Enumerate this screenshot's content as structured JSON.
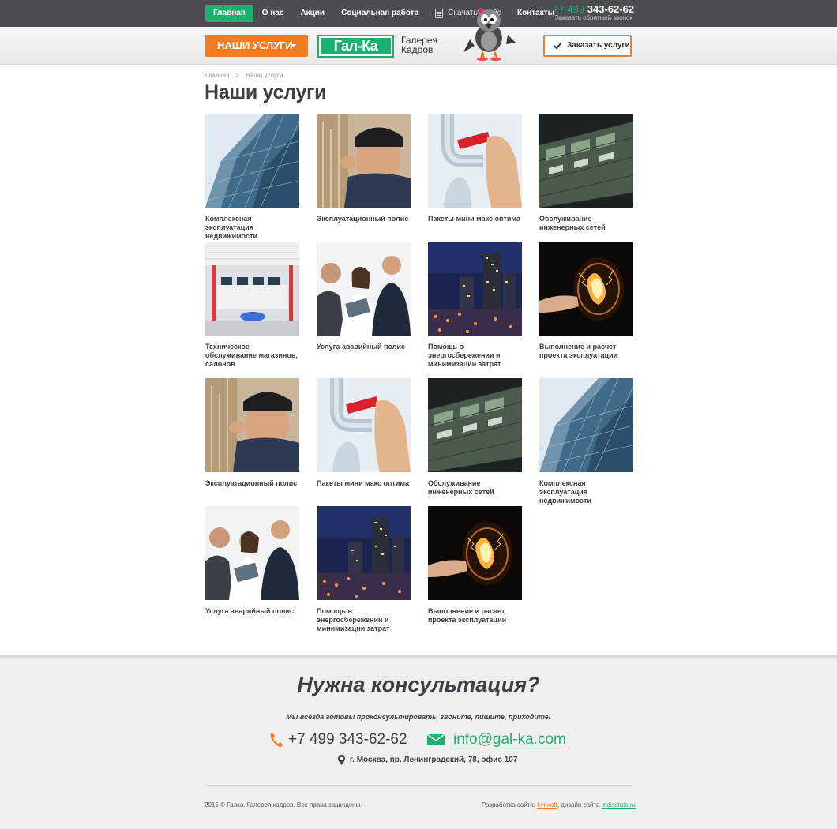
{
  "nav": {
    "items": [
      "Главная",
      "О нас",
      "Акции",
      "Социальная работа"
    ],
    "price_label": "Скачать прайс",
    "contacts_label": "Контакты",
    "phone_code": "+7 499",
    "phone_number": "343-62-62",
    "callback_label": "Заказать обратный звонок"
  },
  "header": {
    "services_button": "НАШИ УСЛУГИ",
    "logo_mark": "Гал-Ка",
    "logo_line1": "Галерея",
    "logo_line2": "Кадров",
    "order_button": "Заказать услуги"
  },
  "breadcrumb": {
    "home": "Главная",
    "separator": ">",
    "current": "Наши услуги"
  },
  "page_title": "Наши услуги",
  "services": [
    {
      "title": "Комплексная эксплуатация недвижимости",
      "image": "glass-skyscraper"
    },
    {
      "title": "Эксплуатационный  полис",
      "image": "technician-wiring"
    },
    {
      "title": "Пакеты мини макс оптима",
      "image": "plumbing-wrench"
    },
    {
      "title": "Обслуживание инженерных сетей",
      "image": "server-rack"
    },
    {
      "title": "Техническое обслуживание магазинов, салонов",
      "image": "store-interior"
    },
    {
      "title": "Услуга аварийный полис",
      "image": "business-people"
    },
    {
      "title": "Помощь в энергосбережении и минимизации затрат",
      "image": "night-city"
    },
    {
      "title": "Выполнение и расчет проекта эксплуатации",
      "image": "glowing-bulb"
    },
    {
      "title": "Эксплуатационный  полис",
      "image": "technician-wiring"
    },
    {
      "title": "Пакеты мини макс оптима",
      "image": "plumbing-wrench"
    },
    {
      "title": "Обслуживание инженерных сетей",
      "image": "server-rack"
    },
    {
      "title": "Комплексная эксплуатация недвижимости",
      "image": "glass-skyscraper"
    },
    {
      "title": "Услуга аварийный полис",
      "image": "business-people"
    },
    {
      "title": "Помощь в энергосбережении и минимизации затрат",
      "image": "night-city"
    },
    {
      "title": "Выполнение и расчет проекта эксплуатации",
      "image": "glowing-bulb"
    }
  ],
  "consult": {
    "title": "Нужна консультация?",
    "subtitle": "Мы всегда готовы проконсультировать, звоните, пишите, приходите!",
    "phone": "+7 499 343-62-62",
    "email": "info@gal-ka.com",
    "address": "г. Москва, пр. Ленинградский, 78, офис 107"
  },
  "footer": {
    "copyright": "2015 © Галка. Галерея кадров. Все права защищены.",
    "dev_label": "Разработка сайта:",
    "dev_link": "Lynxoft",
    "design_label": ", дизайн сайта",
    "design_link": "mdisstuio.ru"
  },
  "colors": {
    "accent_green": "#1db170",
    "accent_orange": "#f47b20",
    "topbar": "#4a4d52",
    "text_dark": "#3c3f44"
  }
}
